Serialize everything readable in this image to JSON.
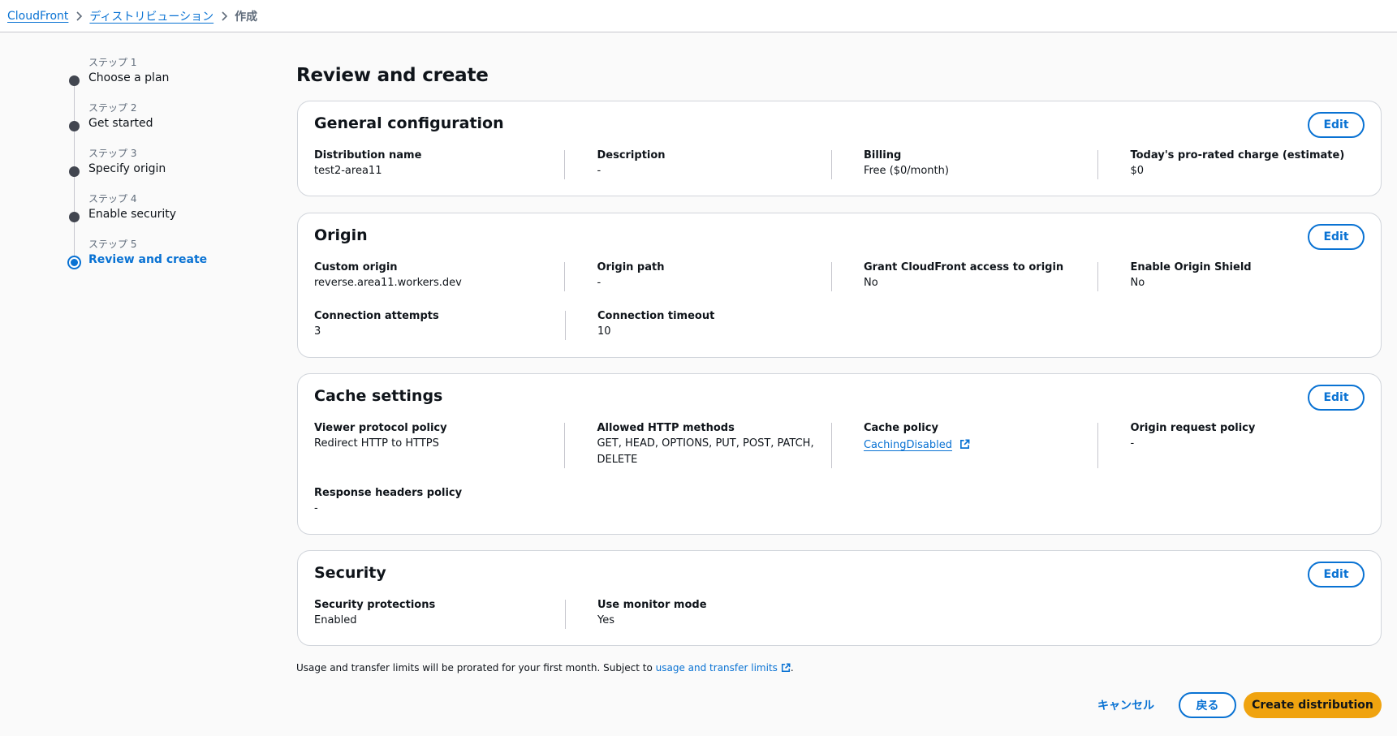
{
  "breadcrumb": {
    "root": "CloudFront",
    "section": "ディストリビューション",
    "current": "作成"
  },
  "steps": [
    {
      "num": "ステップ 1",
      "label": "Choose a plan"
    },
    {
      "num": "ステップ 2",
      "label": "Get started"
    },
    {
      "num": "ステップ 3",
      "label": "Specify origin"
    },
    {
      "num": "ステップ 4",
      "label": "Enable security"
    },
    {
      "num": "ステップ 5",
      "label": "Review and create"
    }
  ],
  "page_title": "Review and create",
  "edit_label": "Edit",
  "general": {
    "title": "General configuration",
    "fields": [
      {
        "label": "Distribution name",
        "value": "test2-area11"
      },
      {
        "label": "Description",
        "value": "-"
      },
      {
        "label": "Billing",
        "value": "Free ($0/month)"
      },
      {
        "label": "Today's pro-rated charge (estimate)",
        "value": "$0"
      }
    ]
  },
  "origin": {
    "title": "Origin",
    "fields": [
      {
        "label": "Custom origin",
        "value": "reverse.area11.workers.dev"
      },
      {
        "label": "Origin path",
        "value": "-"
      },
      {
        "label": "Grant CloudFront access to origin",
        "value": "No"
      },
      {
        "label": "Enable Origin Shield",
        "value": "No"
      },
      {
        "label": "Connection attempts",
        "value": "3"
      },
      {
        "label": "Connection timeout",
        "value": "10"
      }
    ]
  },
  "cache": {
    "title": "Cache settings",
    "fields": [
      {
        "label": "Viewer protocol policy",
        "value": "Redirect HTTP to HTTPS"
      },
      {
        "label": "Allowed HTTP methods",
        "value": "GET, HEAD, OPTIONS, PUT, POST, PATCH,",
        "value2": "DELETE"
      },
      {
        "label": "Cache policy",
        "value": "CachingDisabled"
      },
      {
        "label": "Origin request policy",
        "value": "-"
      },
      {
        "label": "Response headers policy",
        "value": "-"
      }
    ]
  },
  "security": {
    "title": "Security",
    "fields": [
      {
        "label": "Security protections",
        "value": "Enabled"
      },
      {
        "label": "Use monitor mode",
        "value": "Yes"
      }
    ]
  },
  "footer": {
    "note_prefix": "Usage and transfer limits will be prorated for your first month. Subject to ",
    "note_link": "usage and transfer limits",
    "note_suffix": "."
  },
  "actions": {
    "cancel": "キャンセル",
    "back": "戻る",
    "create": "Create distribution"
  },
  "colors": {
    "accent": "#0972d3",
    "primary_button": "#f0a30f",
    "step_inactive": "#424650"
  }
}
